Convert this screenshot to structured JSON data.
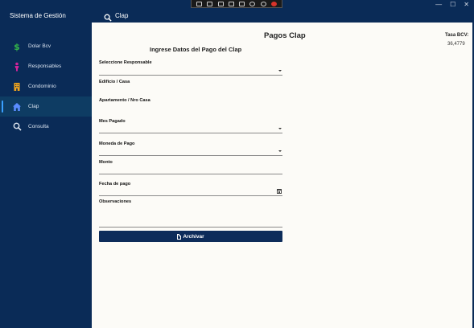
{
  "app": {
    "title": "Sistema de Gestión"
  },
  "window": {
    "controls": [
      "—",
      "☐",
      "✕"
    ]
  },
  "sidebar": {
    "items": [
      {
        "label": "Dolar Bcv",
        "icon": "dollar-icon",
        "color": "#33b34a"
      },
      {
        "label": "Responsables",
        "icon": "person-icon",
        "color": "#d0249a"
      },
      {
        "label": "Condominio",
        "icon": "building-icon",
        "color": "#f2a51c"
      },
      {
        "label": "Clap",
        "icon": "home-icon",
        "color": "#5a8cff",
        "active": true
      },
      {
        "label": "Consulta",
        "icon": "search-icon",
        "color": "#dfe6f0"
      }
    ]
  },
  "header": {
    "title": "Clap",
    "icon": "search-icon"
  },
  "page": {
    "title": "Pagos Clap",
    "tasa_label": "Tasa BCV:",
    "tasa_value": "36,4779",
    "form_title": "Ingrese Datos del Pago del Clap"
  },
  "form": {
    "responsable_label": "Seleccione Responsable",
    "edificio_label": "Edificio / Casa",
    "apartamento_label": "Apartamento / Nro Casa",
    "mes_label": "Mes Pagado",
    "moneda_label": "Moneda de Pago",
    "monto_label": "Monto",
    "fecha_label": "Fecha de pago",
    "observaciones_label": "Observaciones",
    "archive_label": "Archivar"
  },
  "colors": {
    "navy": "#0a2b57",
    "content_bg": "#fcfbf7",
    "button_bg": "#0d2c5a",
    "active_item_bg": "#0e3c63"
  }
}
